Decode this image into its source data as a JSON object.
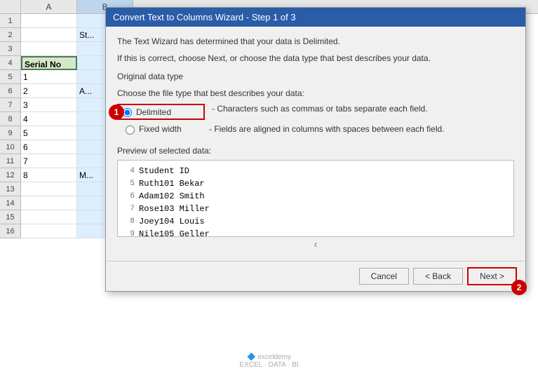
{
  "spreadsheet": {
    "col_headers": [
      "A",
      "B"
    ],
    "rows": [
      {
        "num": 1,
        "cells": [
          "",
          ""
        ]
      },
      {
        "num": 2,
        "cells": [
          "",
          "St..."
        ]
      },
      {
        "num": 3,
        "cells": [
          "",
          ""
        ]
      },
      {
        "num": 4,
        "cells": [
          "Serial No",
          ""
        ]
      },
      {
        "num": 5,
        "cells": [
          "1",
          ""
        ]
      },
      {
        "num": 6,
        "cells": [
          "2",
          "A..."
        ]
      },
      {
        "num": 7,
        "cells": [
          "3",
          ""
        ]
      },
      {
        "num": 8,
        "cells": [
          "4",
          ""
        ]
      },
      {
        "num": 9,
        "cells": [
          "5",
          ""
        ]
      },
      {
        "num": 10,
        "cells": [
          "6",
          ""
        ]
      },
      {
        "num": 11,
        "cells": [
          "7",
          ""
        ]
      },
      {
        "num": 12,
        "cells": [
          "8",
          "M..."
        ]
      },
      {
        "num": 13,
        "cells": [
          "",
          ""
        ]
      },
      {
        "num": 14,
        "cells": [
          "",
          ""
        ]
      },
      {
        "num": 15,
        "cells": [
          "",
          ""
        ]
      },
      {
        "num": 16,
        "cells": [
          "",
          ""
        ]
      }
    ]
  },
  "dialog": {
    "title": "Convert Text to Columns Wizard - Step 1 of 3",
    "description1": "The Text Wizard has determined that your data is Delimited.",
    "description2": "If this is correct, choose Next, or choose the data type that best describes your data.",
    "section_label": "Original data type",
    "file_type_label": "Choose the file type that best describes your data:",
    "options": [
      {
        "label": "Delimited",
        "desc": "- Characters such as commas or tabs separate each field.",
        "checked": true
      },
      {
        "label": "Fixed width",
        "desc": "- Fields are aligned in columns with spaces between each field.",
        "checked": false
      }
    ],
    "preview_label": "Preview of selected data:",
    "preview_lines": [
      {
        "num": "4",
        "text": "Student ID"
      },
      {
        "num": "5",
        "text": "Ruth101 Bekar"
      },
      {
        "num": "6",
        "text": "Adam102 Smith"
      },
      {
        "num": "7",
        "text": "Rose103 Miller"
      },
      {
        "num": "8",
        "text": "Joey104 Louis"
      },
      {
        "num": "9",
        "text": "Nile105 Geller"
      }
    ],
    "buttons": {
      "cancel": "Cancel",
      "back": "< Back",
      "next": "Next >"
    },
    "step1_badge": "1",
    "step2_badge": "2"
  },
  "watermark": "exceldemy\nEXCEL · DATA · BI"
}
